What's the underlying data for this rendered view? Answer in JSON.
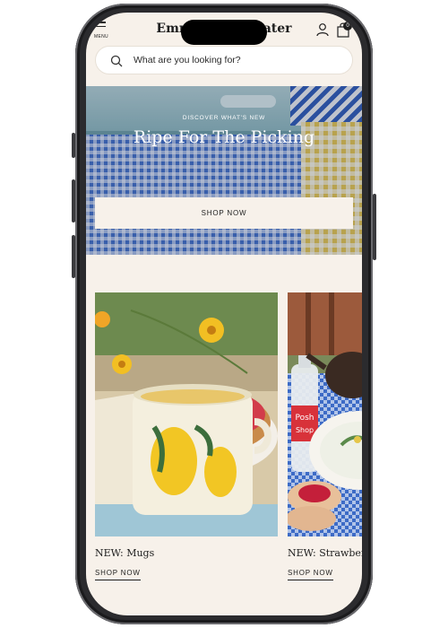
{
  "header": {
    "brand": "Emma Bridgewater",
    "menu_label": "MENU",
    "bag_count": "0"
  },
  "search": {
    "placeholder": "What are you looking for?"
  },
  "hero": {
    "kicker": "DISCOVER WHAT'S NEW",
    "title": "Ripe For The Picking",
    "button_label": "SHOP NOW"
  },
  "products": [
    {
      "title": "NEW: Mugs",
      "link_label": "SHOP NOW"
    },
    {
      "title": "NEW: Strawberries",
      "link_label": "SHOP NOW"
    }
  ],
  "product_image_text": {
    "bottle_label": "The Posh Shop"
  },
  "colors": {
    "page_background": "#f7f1ea",
    "hero_blue": "#3f6cc6",
    "text": "#1e1e1e"
  },
  "icons": [
    "menu-icon",
    "user-icon",
    "bag-icon",
    "search-icon"
  ]
}
